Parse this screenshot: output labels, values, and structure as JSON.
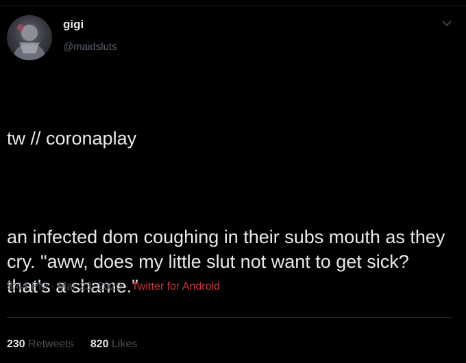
{
  "profile": {
    "display_name": "gigi",
    "handle": "@maidsluts"
  },
  "tweet": {
    "line_trigger": "tw // coronaplay",
    "line_body": "an infected dom coughing in their subs mouth as they cry. \"aww, does my little slut not want to get sick? that's a shame.\""
  },
  "meta": {
    "time": "8:44 PM",
    "separator_1": " · ",
    "date": "Mar 23, 2020",
    "separator_2": " · ",
    "source": "Twitter for Android"
  },
  "stats": {
    "retweets_count": "230",
    "retweets_label": "Retweets",
    "likes_count": "820",
    "likes_label": "Likes"
  },
  "colors": {
    "background": "#000000",
    "text": "#e9e9e9",
    "muted": "#4a5058",
    "source_link": "#c53b3b"
  }
}
